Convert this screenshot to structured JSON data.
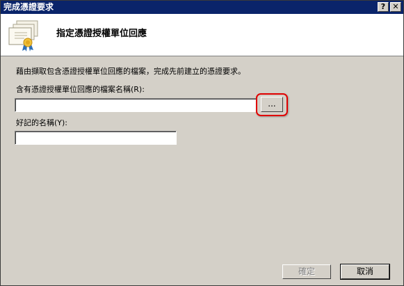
{
  "window": {
    "title": "完成憑證要求",
    "help_button": "?",
    "close_button": "✕"
  },
  "header": {
    "title": "指定憑證授權單位回應",
    "icon": "certificate-icon"
  },
  "body": {
    "description": "藉由擷取包含憑證授權單位回應的檔案，完成先前建立的憑證要求。",
    "file_label": "含有憑證授權單位回應的檔案名稱(R):",
    "file_value": "",
    "browse_label": "...",
    "name_label": "好記的名稱(Y):",
    "name_value": ""
  },
  "footer": {
    "ok_label": "確定",
    "cancel_label": "取消"
  },
  "colors": {
    "titlebar": "#0a246a",
    "dialog_bg": "#d4d0c8",
    "highlight": "#e00000"
  }
}
